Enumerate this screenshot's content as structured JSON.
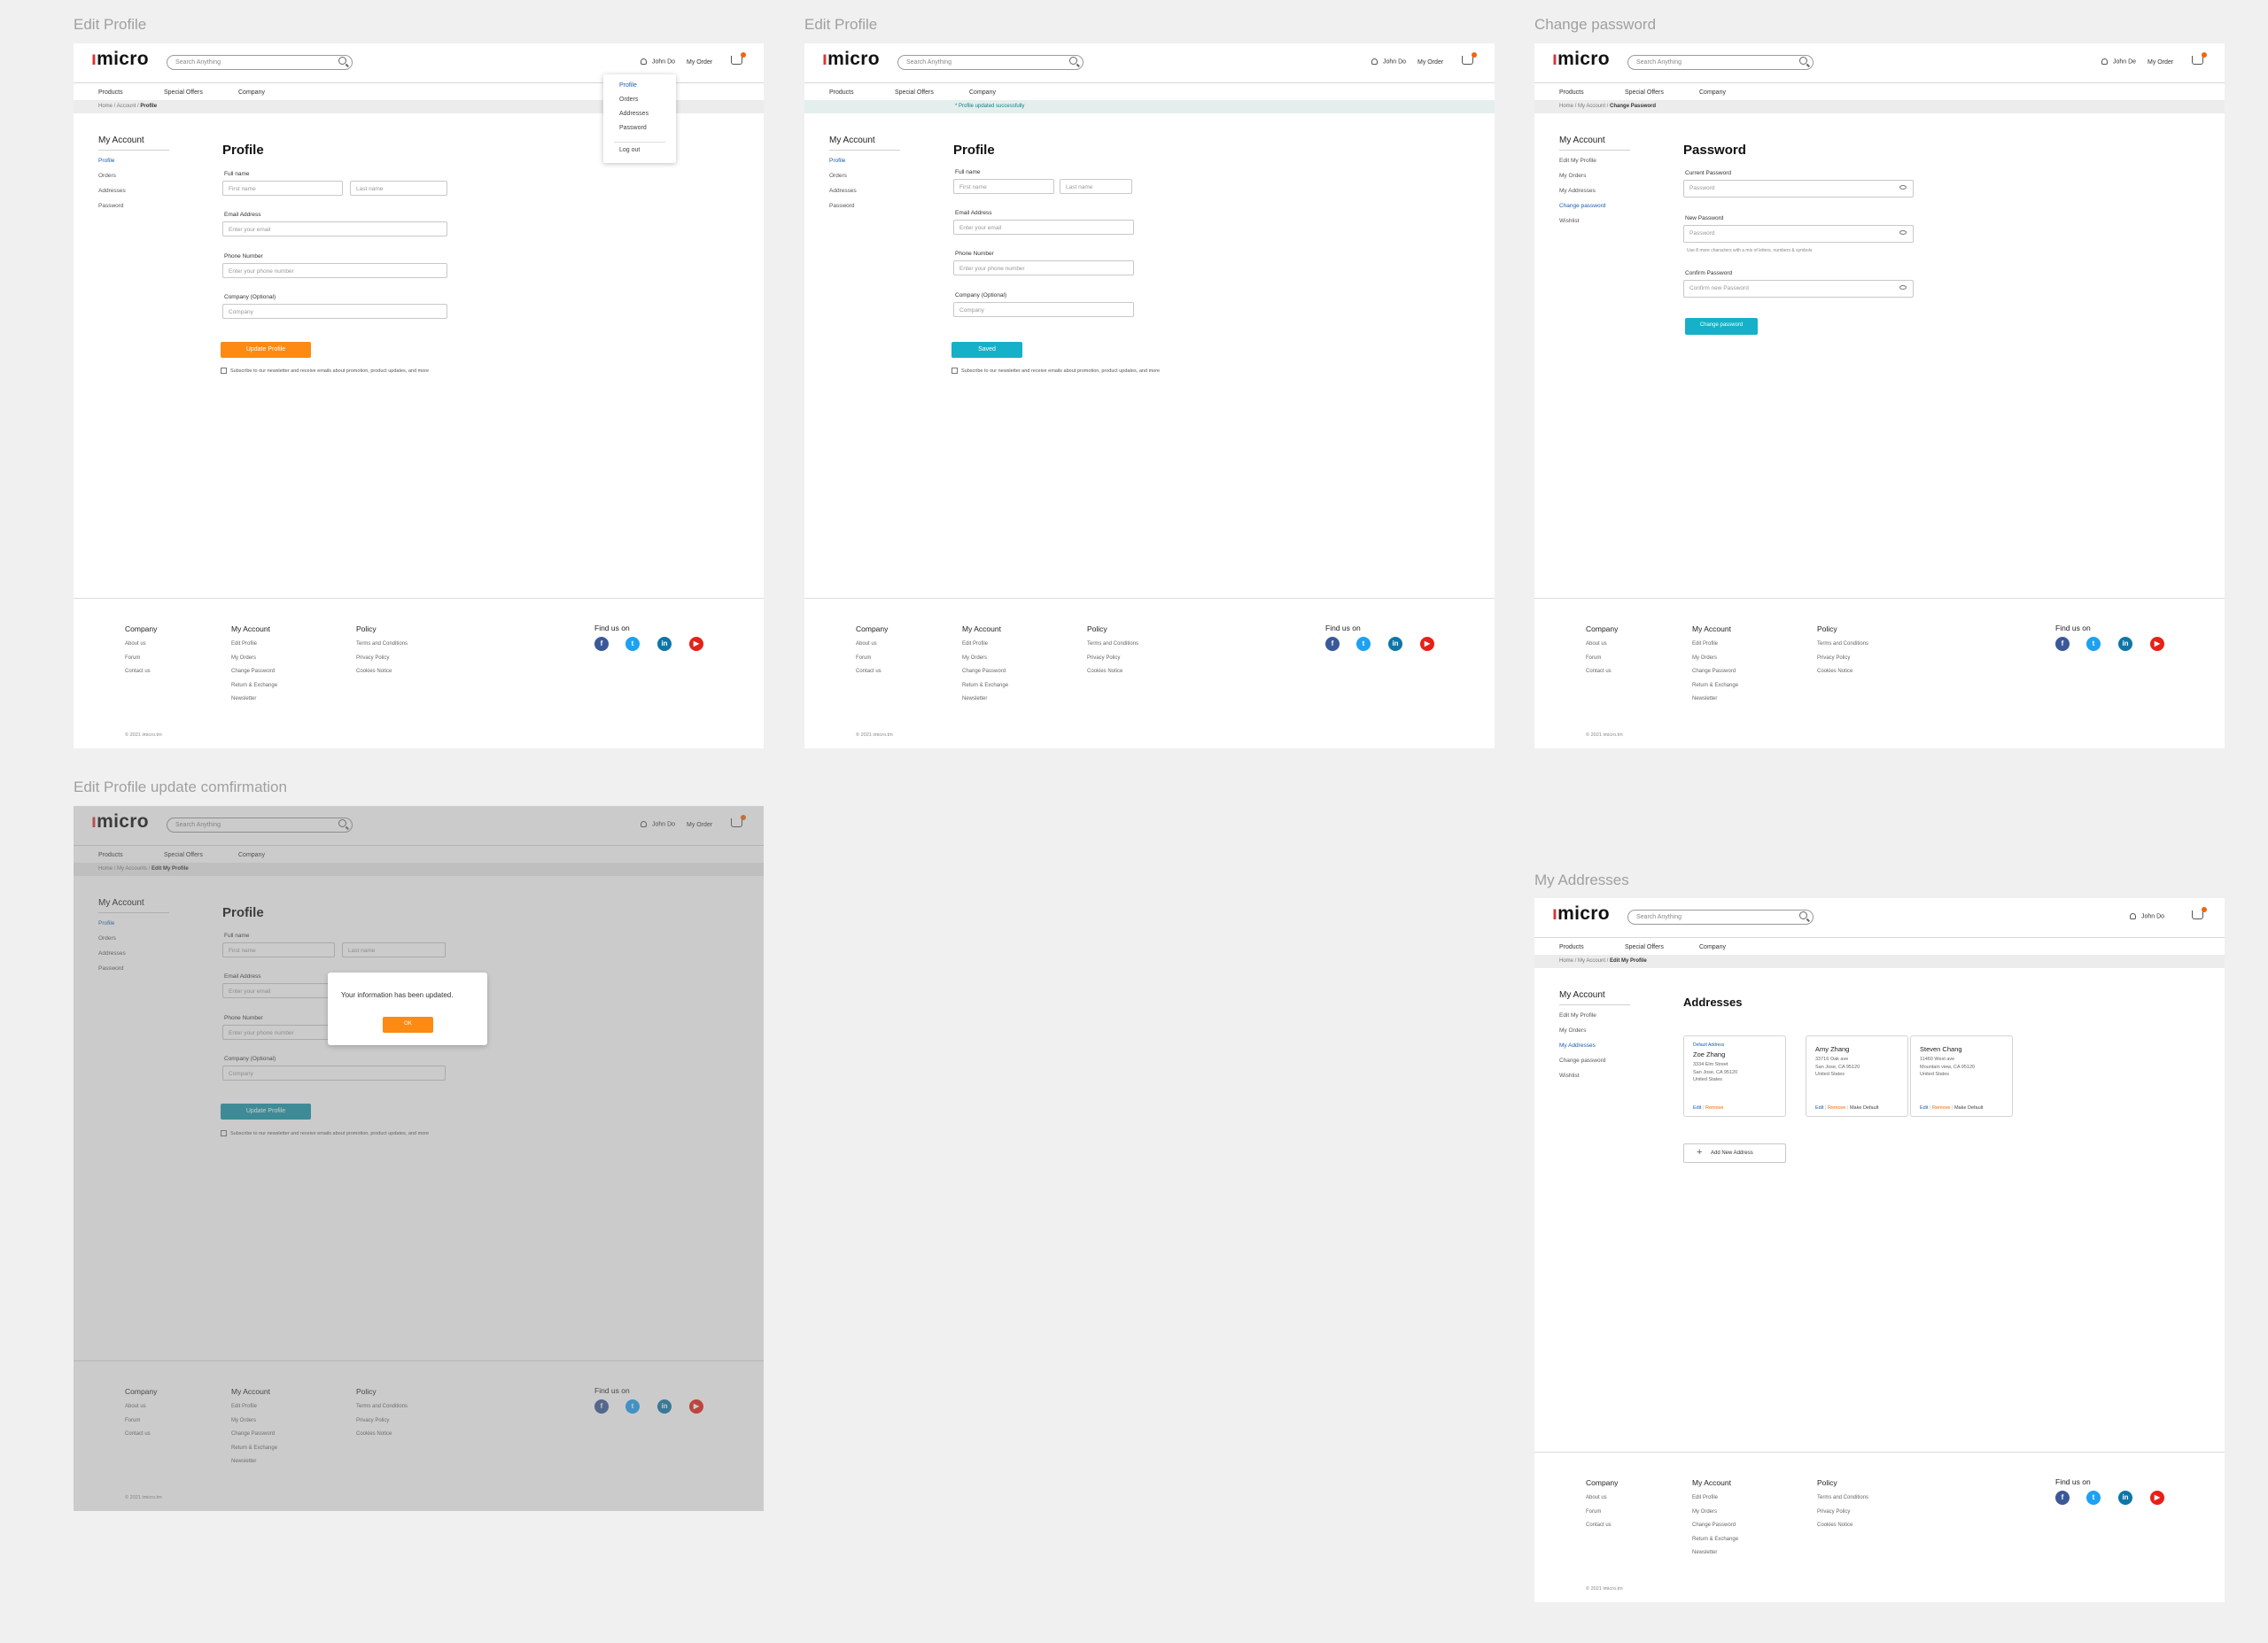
{
  "frame_labels": {
    "f1": "Edit Profile",
    "f2": "Edit Profile",
    "f3": "Change password",
    "f4": "Edit Profile update comfirmation",
    "f5": "My Addresses"
  },
  "common": {
    "logo": "micro",
    "search_placeholder": "Search Anything",
    "nav": [
      "Products",
      "Special Offers",
      "Company"
    ],
    "order": "My Order",
    "footer": {
      "company_title": "Company",
      "company_links": [
        "About us",
        "Forum",
        "Contact us"
      ],
      "account_title": "My Account",
      "account_links": [
        "Edit Profile",
        "My Orders",
        "Change Password",
        "Return & Exchange",
        "Newsletter"
      ],
      "policy_title": "Policy",
      "policy_links": [
        "Terms and Conditions",
        "Privacy Policy",
        "Cookies Notice"
      ],
      "find_us": "Find us on",
      "social_icons": [
        "facebook-icon",
        "twitter-icon",
        "linkedin-icon",
        "youtube-icon"
      ],
      "copyright": "© 2021 imicro.tm"
    },
    "colors": {
      "orange": "#fd8a12",
      "teal": "#16b0c8",
      "link": "#1a5dad",
      "facebook": "#3b5998",
      "twitter": "#1da1f2",
      "linkedin": "#0e76a8",
      "youtube": "#e62117"
    }
  },
  "f1": {
    "user": "John Do",
    "crumb_pre": "Home /  Account / ",
    "crumb_cur": "Profile",
    "sidebar_title": "My Account",
    "sidebar": [
      "Profile",
      "Orders",
      "Addresses",
      "Password"
    ],
    "title": "Profile",
    "fullname_label": "Full name",
    "first_ph": "First name",
    "last_ph": "Last name",
    "email_label": "Email Address",
    "email_ph": "Enter your email",
    "phone_label": "Phone Number",
    "phone_ph": "Enter your phone number",
    "company_label": "Company (Optional)",
    "company_ph": "Company",
    "button": "Update Profile",
    "subscribe": "Subscribe to our newsletter and receive emails about promotion, product updates, and more",
    "dropdown": [
      "Profile",
      "Orders",
      "Addresses",
      "Password",
      "Log out"
    ]
  },
  "f2": {
    "user": "John Do",
    "banner": "* Profile updated successfully",
    "sidebar_title": "My Account",
    "sidebar": [
      "Profile",
      "Orders",
      "Addresses",
      "Password"
    ],
    "title": "Profile",
    "fullname_label": "Full name",
    "first_ph": "First name",
    "last_ph": "Last name",
    "email_label": "Email Address",
    "email_ph": "Enter your email",
    "phone_label": "Phone Number",
    "phone_ph": "Enter your phone number",
    "company_label": "Company (Optional)",
    "company_ph": "Company",
    "button": "Saved",
    "subscribe": "Subscribe to our newsletter and receive emails about promotion, product updates, and more"
  },
  "f3": {
    "user": "John De",
    "crumb_pre": "Home /  My Account / ",
    "crumb_cur": "Change Password",
    "sidebar_title": "My Account",
    "sidebar": [
      "Edit My Profile",
      "My Orders",
      "My Addresses",
      "Change password",
      "Wishlist"
    ],
    "title": "Password",
    "current_label": "Current Password",
    "current_ph": "Password",
    "new_label": "New Password",
    "new_ph": "Password",
    "hint": "Use 8 more characters with a mix of letters, numbers & symbols",
    "confirm_label": "Confirm Password",
    "confirm_ph": "Confirm new Password",
    "button": "Change password"
  },
  "f4": {
    "user": "John Do",
    "crumb_pre": "Home /  My Accounts / ",
    "crumb_cur": "Edit My Profile",
    "sidebar_title": "My Account",
    "sidebar": [
      "Profile",
      "Orders",
      "Addresses",
      "Password"
    ],
    "title": "Profile",
    "fullname_label": "Full name",
    "first_ph": "First name",
    "last_ph": "Last name",
    "email_label": "Email Address",
    "email_ph": "Enter your email",
    "phone_label": "Phone Number",
    "phone_ph": "Enter your phone number",
    "company_label": "Company (Optional)",
    "company_ph": "Company",
    "button": "Update Profile",
    "subscribe": "Subscribe to our newsletter and receive emails about promotion, product updates, and more",
    "modal_text": "Your information has been updated.",
    "modal_ok": "OK"
  },
  "f5": {
    "user": "John Do",
    "crumb_pre": "Home /  My Account / ",
    "crumb_cur": "Edit My Profile",
    "sidebar_title": "My Account",
    "sidebar": [
      "Edit My Profile",
      "My Orders",
      "My Addresses",
      "Change password",
      "Wishlist"
    ],
    "title": "Addresses",
    "cards": [
      {
        "default_label": "Default Address",
        "name": "Zoe Zhang",
        "lines": [
          "3334 Elm Street",
          "San Jose, CA 95120",
          "United States"
        ],
        "edit": "Edit",
        "remove": "Remove",
        "make_default": ""
      },
      {
        "default_label": "",
        "name": "Amy Zhang",
        "lines": [
          "33716 Oak ave",
          "San Jose, CA 95120",
          "United States"
        ],
        "edit": "Edit",
        "remove": "Remove",
        "make_default": "Make Default"
      },
      {
        "default_label": "",
        "name": "Steven Chang",
        "lines": [
          "11460 West ave",
          "Mountain view, CA 95120",
          "United States"
        ],
        "edit": "Edit",
        "remove": "Remove",
        "make_default": "Make Default"
      }
    ],
    "add_new": "Add New Address"
  }
}
